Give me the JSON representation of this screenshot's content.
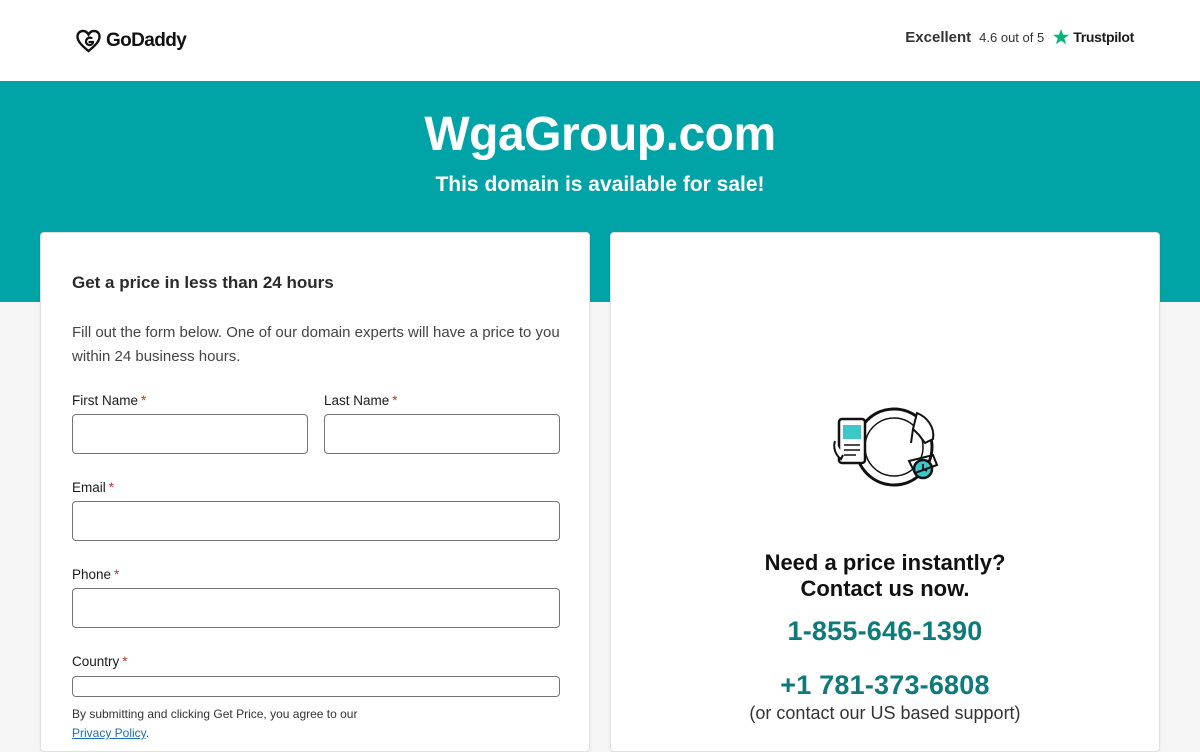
{
  "header": {
    "logo_text": "GoDaddy",
    "rating_label": "Excellent",
    "rating_score": "4.6 out of 5",
    "rating_brand": "Trustpilot"
  },
  "hero": {
    "domain": "WgaGroup.com",
    "subtitle": "This domain is available for sale!"
  },
  "form": {
    "title": "Get a price in less than 24 hours",
    "description": "Fill out the form below. One of our domain experts will have a price to you within 24 business hours.",
    "required_marker": "*",
    "first_name_label": "First Name",
    "first_name_value": "",
    "last_name_label": "Last Name",
    "last_name_value": "",
    "email_label": "Email",
    "email_value": "",
    "phone_label": "Phone",
    "phone_value": "",
    "country_label": "Country",
    "country_value": "",
    "terms_text": "By submitting and clicking Get Price, you agree to our",
    "privacy_link": "Privacy Policy",
    "terms_end": "."
  },
  "contact": {
    "heading_line1": "Need a price instantly?",
    "heading_line2": "Contact us now.",
    "phone_primary": "1-855-646-1390",
    "phone_secondary": "+1 781-373-6808",
    "note": "(or contact our US based support)"
  },
  "colors": {
    "brand_teal": "#00a4a6",
    "phone_teal": "#0d7a7c",
    "trustpilot_green": "#00b67a"
  },
  "icons": {
    "logo": "godaddy-heart-icon",
    "rating": "trustpilot-star-icon",
    "illustration": "phone-clock-hand-illustration"
  }
}
